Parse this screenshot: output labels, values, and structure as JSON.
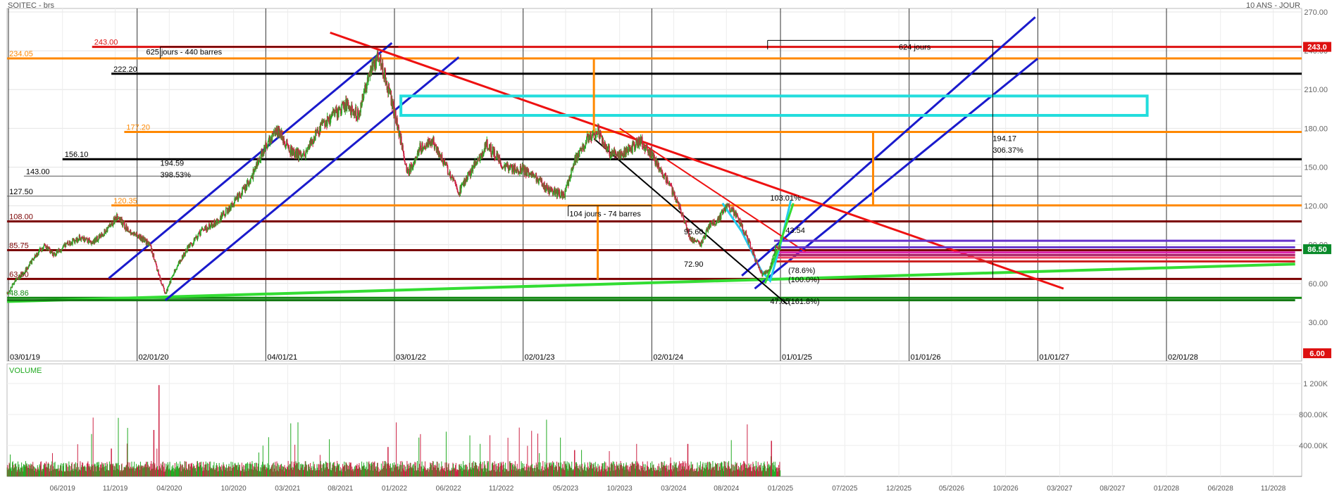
{
  "header": {
    "symbol": "SOITEC - brs",
    "period": "10 ANS - JOUR"
  },
  "volume_label": "VOLUME",
  "chart_data": {
    "type": "candlestick",
    "price_axis": {
      "ticks": [
        30,
        60,
        90,
        120,
        150,
        180,
        210,
        240,
        270
      ],
      "tick_labels": [
        "30.00",
        "60.00",
        "90.00",
        "120.00",
        "150.00",
        "180.00",
        "210.00",
        "240.00",
        "270.00"
      ],
      "range": [
        0,
        270
      ],
      "current_price": "86.50",
      "current_price_color": "#0a8a2a",
      "marker_243": "243.0",
      "marker_243_color": "#dd1111",
      "bottom_marker": "6.00"
    },
    "date_labels": [
      {
        "label": "03/01/19",
        "t": 2019.0
      },
      {
        "label": "02/01/20",
        "t": 2020.0
      },
      {
        "label": "04/01/21",
        "t": 2021.0
      },
      {
        "label": "03/01/22",
        "t": 2022.0
      },
      {
        "label": "02/01/23",
        "t": 2023.0
      },
      {
        "label": "02/01/24",
        "t": 2024.0
      },
      {
        "label": "01/01/25",
        "t": 2025.0
      },
      {
        "label": "01/01/26",
        "t": 2026.0
      },
      {
        "label": "01/01/27",
        "t": 2027.0
      },
      {
        "label": "02/01/28",
        "t": 2028.0
      }
    ],
    "bottom_axis": {
      "labels": [
        "06/2019",
        "11/2019",
        "04/2020",
        "10/2020",
        "03/2021",
        "08/2021",
        "01/2022",
        "06/2022",
        "11/2022",
        "05/2023",
        "10/2023",
        "03/2024",
        "08/2024",
        "01/2025",
        "07/2025",
        "12/2025",
        "05/2026",
        "10/2026",
        "03/2027",
        "08/2027",
        "01/2028",
        "06/2028",
        "11/2028"
      ],
      "t": [
        2019.42,
        2019.83,
        2020.25,
        2020.75,
        2021.17,
        2021.58,
        2022.0,
        2022.42,
        2022.83,
        2023.33,
        2023.75,
        2024.17,
        2024.58,
        2025.0,
        2025.5,
        2025.92,
        2026.33,
        2026.75,
        2027.17,
        2027.58,
        2028.0,
        2028.42,
        2028.83
      ]
    },
    "volume_axis": {
      "ticks": [
        400000,
        800000,
        1200000
      ],
      "tick_labels": [
        "400.00K",
        "800.00K",
        "1 200K"
      ],
      "range": [
        0,
        1400000
      ]
    },
    "price_path": [
      {
        "t": 2018.99,
        "v": 52
      },
      {
        "t": 2019.05,
        "v": 62
      },
      {
        "t": 2019.12,
        "v": 68
      },
      {
        "t": 2019.2,
        "v": 80
      },
      {
        "t": 2019.28,
        "v": 90
      },
      {
        "t": 2019.36,
        "v": 82
      },
      {
        "t": 2019.45,
        "v": 90
      },
      {
        "t": 2019.55,
        "v": 95
      },
      {
        "t": 2019.66,
        "v": 92
      },
      {
        "t": 2019.75,
        "v": 100
      },
      {
        "t": 2019.85,
        "v": 112
      },
      {
        "t": 2019.92,
        "v": 102
      },
      {
        "t": 2020.02,
        "v": 96
      },
      {
        "t": 2020.1,
        "v": 90
      },
      {
        "t": 2020.17,
        "v": 66
      },
      {
        "t": 2020.22,
        "v": 52
      },
      {
        "t": 2020.3,
        "v": 72
      },
      {
        "t": 2020.4,
        "v": 88
      },
      {
        "t": 2020.5,
        "v": 100
      },
      {
        "t": 2020.62,
        "v": 108
      },
      {
        "t": 2020.75,
        "v": 122
      },
      {
        "t": 2020.88,
        "v": 140
      },
      {
        "t": 2021.0,
        "v": 168
      },
      {
        "t": 2021.1,
        "v": 178
      },
      {
        "t": 2021.2,
        "v": 162
      },
      {
        "t": 2021.3,
        "v": 158
      },
      {
        "t": 2021.4,
        "v": 178
      },
      {
        "t": 2021.5,
        "v": 188
      },
      {
        "t": 2021.62,
        "v": 198
      },
      {
        "t": 2021.72,
        "v": 190
      },
      {
        "t": 2021.8,
        "v": 222
      },
      {
        "t": 2021.88,
        "v": 236
      },
      {
        "t": 2021.95,
        "v": 212
      },
      {
        "t": 2022.03,
        "v": 180
      },
      {
        "t": 2022.1,
        "v": 145
      },
      {
        "t": 2022.2,
        "v": 165
      },
      {
        "t": 2022.3,
        "v": 170
      },
      {
        "t": 2022.4,
        "v": 150
      },
      {
        "t": 2022.5,
        "v": 130
      },
      {
        "t": 2022.6,
        "v": 148
      },
      {
        "t": 2022.72,
        "v": 168
      },
      {
        "t": 2022.85,
        "v": 150
      },
      {
        "t": 2023.0,
        "v": 148
      },
      {
        "t": 2023.1,
        "v": 142
      },
      {
        "t": 2023.2,
        "v": 132
      },
      {
        "t": 2023.32,
        "v": 128
      },
      {
        "t": 2023.4,
        "v": 155
      },
      {
        "t": 2023.5,
        "v": 172
      },
      {
        "t": 2023.58,
        "v": 178
      },
      {
        "t": 2023.68,
        "v": 160
      },
      {
        "t": 2023.8,
        "v": 162
      },
      {
        "t": 2023.92,
        "v": 170
      },
      {
        "t": 2024.02,
        "v": 156
      },
      {
        "t": 2024.12,
        "v": 140
      },
      {
        "t": 2024.22,
        "v": 118
      },
      {
        "t": 2024.3,
        "v": 95
      },
      {
        "t": 2024.38,
        "v": 90
      },
      {
        "t": 2024.45,
        "v": 105
      },
      {
        "t": 2024.52,
        "v": 110
      },
      {
        "t": 2024.58,
        "v": 120
      },
      {
        "t": 2024.65,
        "v": 114
      },
      {
        "t": 2024.73,
        "v": 98
      },
      {
        "t": 2024.8,
        "v": 80
      },
      {
        "t": 2024.86,
        "v": 66
      },
      {
        "t": 2024.92,
        "v": 72
      },
      {
        "t": 2024.97,
        "v": 90
      },
      {
        "t": 2025.0,
        "v": 86.5
      }
    ],
    "horizontal_levels": [
      {
        "value": 243.0,
        "color": "#dd1111",
        "label": "243.00",
        "from": 2019.65
      },
      {
        "value": 234.05,
        "color": "#ff8800",
        "label": "234.05",
        "from": 2018.99
      },
      {
        "value": 222.2,
        "color": "#000000",
        "label": "222.20",
        "from": 2019.8
      },
      {
        "value": 177.2,
        "color": "#ff8800",
        "label": "177.20",
        "from": 2019.9
      },
      {
        "value": 156.1,
        "color": "#000000",
        "label": "156.10",
        "from": 2019.42
      },
      {
        "value": 143.0,
        "color": "#555555",
        "label": "143.00",
        "from": 2019.12
      },
      {
        "value": 127.5,
        "color": "#555555",
        "label": "127.50",
        "from": 2018.99
      },
      {
        "value": 120.35,
        "color": "#ff8800",
        "label": "120.35",
        "from": 2019.8
      },
      {
        "value": 108.0,
        "color": "#7a0000",
        "label": "108.00",
        "from": 2018.99
      },
      {
        "value": 85.75,
        "color": "#7a0000",
        "label": "85.75",
        "from": 2018.99
      },
      {
        "value": 63.5,
        "color": "#7a0000",
        "label": "63.50",
        "from": 2018.99
      },
      {
        "value": 48.86,
        "color": "#118811",
        "label": "48.86",
        "from": 2018.99
      }
    ],
    "annotations": [
      {
        "text": "625 jours - 440 barres",
        "t": 2020.07,
        "v": 237
      },
      {
        "text": "624 jours",
        "t": 2025.92,
        "v": 241
      },
      {
        "text": "194.59",
        "t": 2020.18,
        "v": 151
      },
      {
        "text": "398.53%",
        "t": 2020.18,
        "v": 142
      },
      {
        "text": "194.17",
        "t": 2026.65,
        "v": 170
      },
      {
        "text": "306.37%",
        "t": 2026.65,
        "v": 161
      },
      {
        "text": "104 jours - 74 barres",
        "t": 2023.36,
        "v": 112
      },
      {
        "text": "95.60",
        "t": 2024.25,
        "v": 98
      },
      {
        "text": "72.90",
        "t": 2024.25,
        "v": 73
      },
      {
        "text": "103.01%",
        "t": 2024.92,
        "v": 124
      },
      {
        "text": "43.54",
        "t": 2025.04,
        "v": 99
      },
      {
        "text": "(78.6%)",
        "t": 2025.06,
        "v": 68
      },
      {
        "text": "(100.0%)",
        "t": 2025.06,
        "v": 61
      },
      {
        "text": "47.05",
        "t": 2024.92,
        "v": 44
      },
      {
        "text": "(161.8%)",
        "t": 2025.06,
        "v": 44
      }
    ],
    "colors": {
      "up": "#22aa22",
      "down": "#cc2244",
      "channel": "#1a1acc",
      "trend_red": "#ee1111",
      "support_green": "#33dd33",
      "box_cyan": "#22dddd",
      "projection_orange": "#ff8800",
      "fib_purple": "#6633cc",
      "fib_magenta": "#dd22aa",
      "cyan_path": "#22ccee"
    }
  }
}
